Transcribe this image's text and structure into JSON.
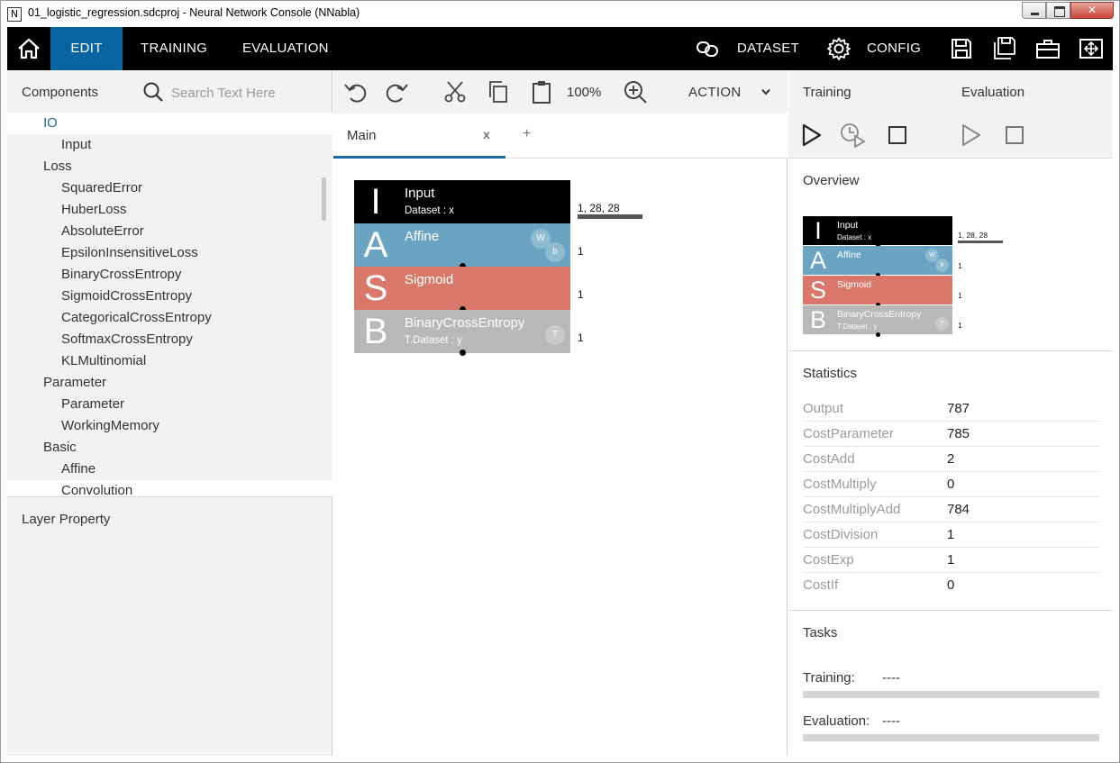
{
  "window": {
    "title": "01_logistic_regression.sdcproj - Neural Network Console (NNabla)",
    "icon_letter": "N"
  },
  "header": {
    "tabs": [
      {
        "label": "EDIT",
        "active": true
      },
      {
        "label": "TRAINING"
      },
      {
        "label": "EVALUATION"
      }
    ],
    "dataset_label": "DATASET",
    "config_label": "CONFIG",
    "icons": [
      "home-icon",
      "dataset-link-icon",
      "gear-icon",
      "save-icon",
      "save-as-icon",
      "toolbox-icon",
      "fit-window-icon"
    ],
    "accent_color": "#0a64a0"
  },
  "components": {
    "title": "Components",
    "search_placeholder": "Search Text Here",
    "tree": [
      {
        "label": "IO",
        "kind": "cat",
        "selected": true
      },
      {
        "label": "Input",
        "kind": "leaf"
      },
      {
        "label": "Loss",
        "kind": "cat"
      },
      {
        "label": "SquaredError",
        "kind": "leaf"
      },
      {
        "label": "HuberLoss",
        "kind": "leaf"
      },
      {
        "label": "AbsoluteError",
        "kind": "leaf"
      },
      {
        "label": "EpsilonInsensitiveLoss",
        "kind": "leaf"
      },
      {
        "label": "BinaryCrossEntropy",
        "kind": "leaf"
      },
      {
        "label": "SigmoidCrossEntropy",
        "kind": "leaf"
      },
      {
        "label": "CategoricalCrossEntropy",
        "kind": "leaf"
      },
      {
        "label": "SoftmaxCrossEntropy",
        "kind": "leaf"
      },
      {
        "label": "KLMultinomial",
        "kind": "leaf"
      },
      {
        "label": "Parameter",
        "kind": "cat"
      },
      {
        "label": "Parameter",
        "kind": "leaf"
      },
      {
        "label": "WorkingMemory",
        "kind": "leaf"
      },
      {
        "label": "Basic",
        "kind": "cat"
      },
      {
        "label": "Affine",
        "kind": "leaf"
      },
      {
        "label": "Convolution",
        "kind": "leaf"
      }
    ],
    "layer_property_title": "Layer Property"
  },
  "editor": {
    "zoom": "100%",
    "action_label": "ACTION",
    "tab_label": "Main",
    "tab_close": "x",
    "tab_add": "+",
    "layers": [
      {
        "letter": "I",
        "name": "Input",
        "sub": "Dataset : x",
        "output": "1, 28, 28",
        "color": "#000000",
        "badges": []
      },
      {
        "letter": "A",
        "name": "Affine",
        "sub": "",
        "output": "1",
        "color": "#6aa4c2",
        "badges": [
          "W",
          "b"
        ]
      },
      {
        "letter": "S",
        "name": "Sigmoid",
        "sub": "",
        "output": "1",
        "color": "#d9786a",
        "badges": []
      },
      {
        "letter": "B",
        "name": "BinaryCrossEntropy",
        "sub": "T.Dataset : y",
        "output": "1",
        "color": "#b8b8b8",
        "badges": [
          "T"
        ]
      }
    ]
  },
  "right": {
    "training_title": "Training",
    "evaluation_title": "Evaluation",
    "overview_title": "Overview",
    "statistics_title": "Statistics",
    "statistics": [
      {
        "name": "Output",
        "value": "787"
      },
      {
        "name": "CostParameter",
        "value": "785"
      },
      {
        "name": "CostAdd",
        "value": "2"
      },
      {
        "name": "CostMultiply",
        "value": "0"
      },
      {
        "name": "CostMultiplyAdd",
        "value": "784"
      },
      {
        "name": "CostDivision",
        "value": "1"
      },
      {
        "name": "CostExp",
        "value": "1"
      },
      {
        "name": "CostIf",
        "value": "0"
      }
    ],
    "tasks_title": "Tasks",
    "tasks": {
      "training_label": "Training:",
      "training_value": "----",
      "training_progress": 0,
      "evaluation_label": "Evaluation:",
      "evaluation_value": "----",
      "evaluation_progress": 0
    }
  }
}
